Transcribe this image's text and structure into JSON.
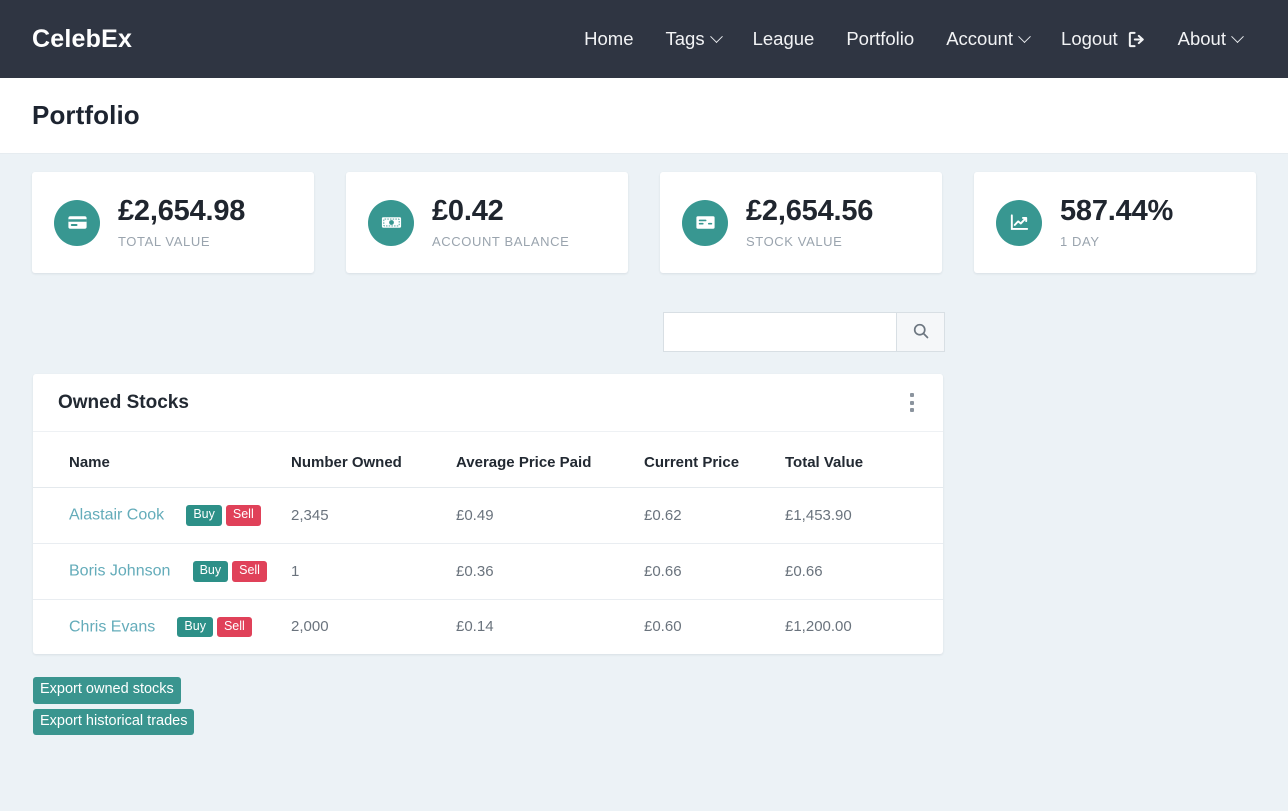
{
  "navbar": {
    "brand": "CelebEx",
    "items": [
      {
        "label": "Home",
        "icon": null,
        "caret": false
      },
      {
        "label": "Tags",
        "icon": "chevron-down-icon",
        "caret": true
      },
      {
        "label": "League",
        "icon": null,
        "caret": false
      },
      {
        "label": "Portfolio",
        "icon": null,
        "caret": false
      },
      {
        "label": "Account",
        "icon": "chevron-down-icon",
        "caret": true
      },
      {
        "label": "Logout",
        "icon": "sign-out-icon",
        "caret": false
      },
      {
        "label": "About",
        "icon": "chevron-down-icon",
        "caret": true
      }
    ]
  },
  "page": {
    "title": "Portfolio"
  },
  "stats": [
    {
      "value": "£2,654.98",
      "label": "TOTAL VALUE",
      "icon": "credit-card-icon"
    },
    {
      "value": "£0.42",
      "label": "ACCOUNT BALANCE",
      "icon": "banknote-icon"
    },
    {
      "value": "£2,654.56",
      "label": "STOCK VALUE",
      "icon": "cheque-icon"
    },
    {
      "value": "587.44%",
      "label": "1 DAY",
      "icon": "chart-line-icon"
    }
  ],
  "search": {
    "value": "",
    "placeholder": "",
    "button_icon": "search-icon"
  },
  "owned_stocks": {
    "title": "Owned Stocks",
    "menu_icon": "kebab-menu-icon",
    "columns": [
      "Name",
      "Number Owned",
      "Average Price Paid",
      "Current Price",
      "Total Value"
    ],
    "buy_label": "Buy",
    "sell_label": "Sell",
    "rows": [
      {
        "name": "Alastair Cook",
        "number_owned": "2,345",
        "average_price_paid": "£0.49",
        "current_price": "£0.62",
        "total_value": "£1,453.90"
      },
      {
        "name": "Boris Johnson",
        "number_owned": "1",
        "average_price_paid": "£0.36",
        "current_price": "£0.66",
        "total_value": "£0.66"
      },
      {
        "name": "Chris Evans",
        "number_owned": "2,000",
        "average_price_paid": "£0.14",
        "current_price": "£0.60",
        "total_value": "£1,200.00"
      }
    ]
  },
  "exports": {
    "owned_stocks_label": "Export owned stocks",
    "historical_trades_label": "Export historical trades"
  },
  "colors": {
    "navbar_bg": "#2f3542",
    "page_bg": "#ecf2f6",
    "accent_teal": "#389791",
    "buy_badge": "#2d9088",
    "sell_badge": "#e04159",
    "link": "#64acba",
    "heading": "#1d2430"
  }
}
